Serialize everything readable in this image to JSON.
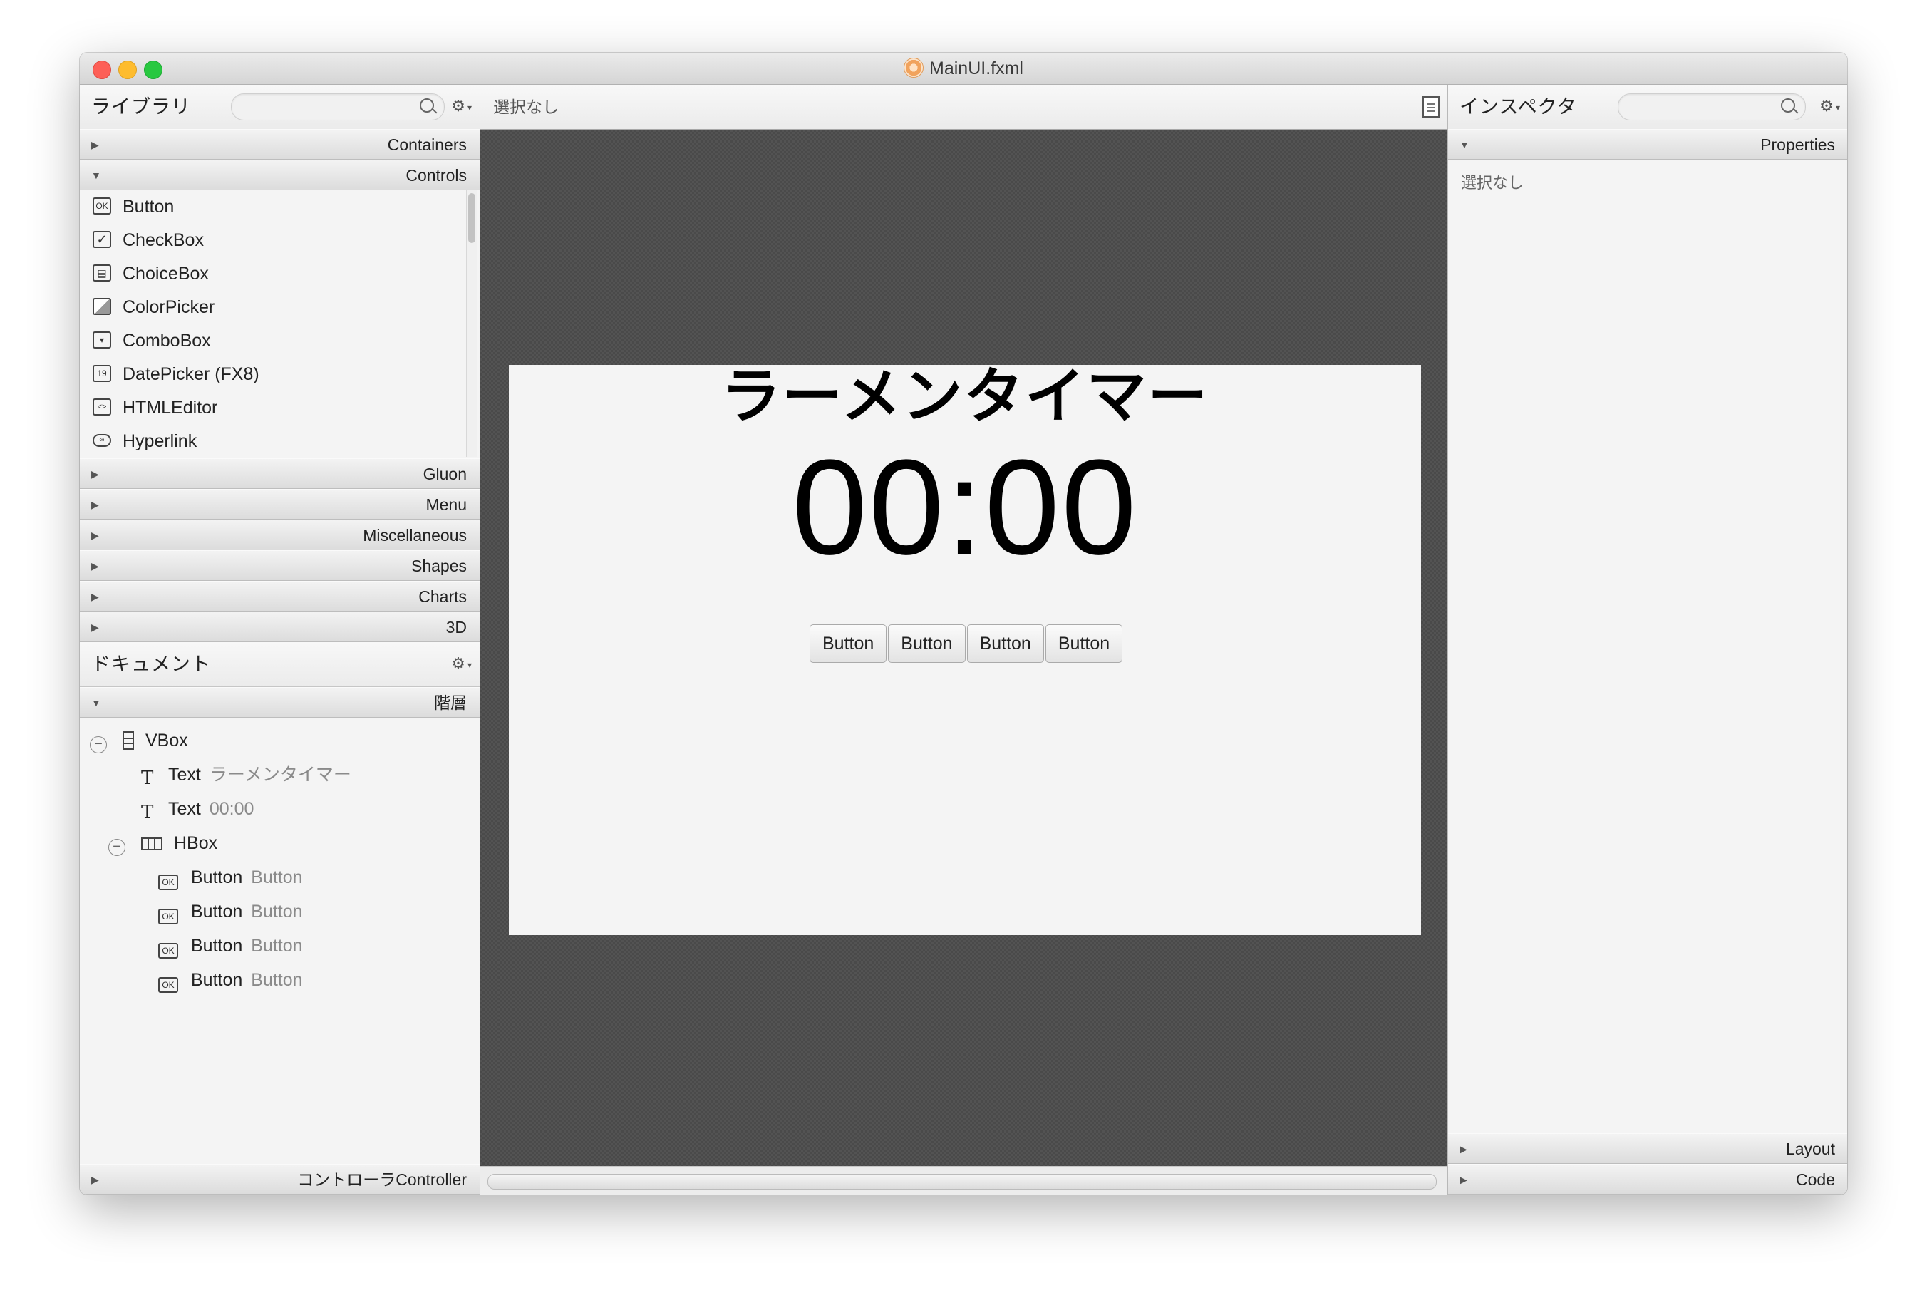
{
  "window": {
    "title": "MainUI.fxml"
  },
  "library": {
    "title": "ライブラリ",
    "search_placeholder": "",
    "sections_top": [
      {
        "label": "Containers",
        "expanded": false
      },
      {
        "label": "Controls",
        "expanded": true
      }
    ],
    "controls": [
      {
        "label": "Button",
        "icon": "ok-button-icon"
      },
      {
        "label": "CheckBox",
        "icon": "checkbox-icon"
      },
      {
        "label": "ChoiceBox",
        "icon": "choicebox-icon"
      },
      {
        "label": "ColorPicker",
        "icon": "colorpicker-icon"
      },
      {
        "label": "ComboBox",
        "icon": "combobox-icon"
      },
      {
        "label": "DatePicker  (FX8)",
        "icon": "datepicker-icon"
      },
      {
        "label": "HTMLEditor",
        "icon": "htmleditor-icon"
      },
      {
        "label": "Hyperlink",
        "icon": "hyperlink-icon"
      }
    ],
    "sections_bottom": [
      {
        "label": "Gluon"
      },
      {
        "label": "Menu"
      },
      {
        "label": "Miscellaneous"
      },
      {
        "label": "Shapes"
      },
      {
        "label": "Charts"
      },
      {
        "label": "3D"
      }
    ]
  },
  "document": {
    "title": "ドキュメント",
    "hierarchy_label": "階層",
    "tree": [
      {
        "type": "VBox",
        "value": "",
        "depth": 0,
        "kind": "vbox"
      },
      {
        "type": "Text",
        "value": "ラーメンタイマー",
        "depth": 1,
        "kind": "text"
      },
      {
        "type": "Text",
        "value": "00:00",
        "depth": 1,
        "kind": "text"
      },
      {
        "type": "HBox",
        "value": "",
        "depth": 1,
        "kind": "hbox"
      },
      {
        "type": "Button",
        "value": "Button",
        "depth": 2,
        "kind": "button"
      },
      {
        "type": "Button",
        "value": "Button",
        "depth": 2,
        "kind": "button"
      },
      {
        "type": "Button",
        "value": "Button",
        "depth": 2,
        "kind": "button"
      },
      {
        "type": "Button",
        "value": "Button",
        "depth": 2,
        "kind": "button"
      }
    ],
    "controller_label": "コントローラController"
  },
  "center": {
    "selection": "選択なし",
    "stage": {
      "title": "ラーメンタイマー",
      "time": "00:00",
      "buttons": [
        "Button",
        "Button",
        "Button",
        "Button"
      ]
    }
  },
  "inspector": {
    "title": "インスペクタ",
    "properties_label": "Properties",
    "empty_text": "選択なし",
    "layout_label": "Layout",
    "code_label": "Code"
  }
}
